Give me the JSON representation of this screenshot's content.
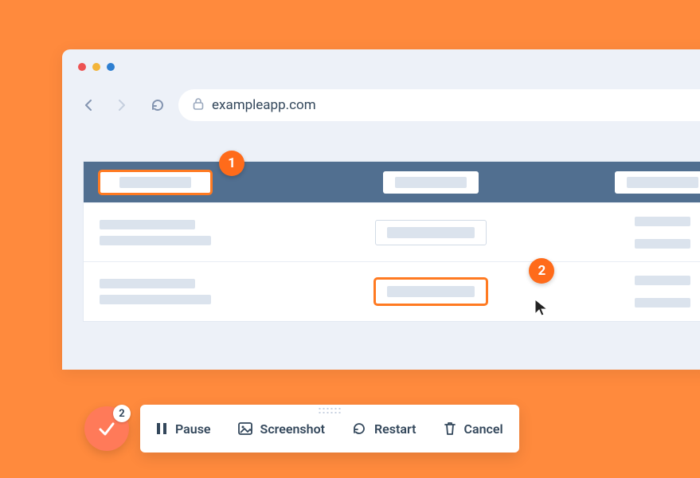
{
  "url": "exampleapp.com",
  "markers": {
    "one": "1",
    "two": "2"
  },
  "recorder": {
    "count": "2",
    "pause": "Pause",
    "screenshot": "Screenshot",
    "restart": "Restart",
    "cancel": "Cancel"
  }
}
